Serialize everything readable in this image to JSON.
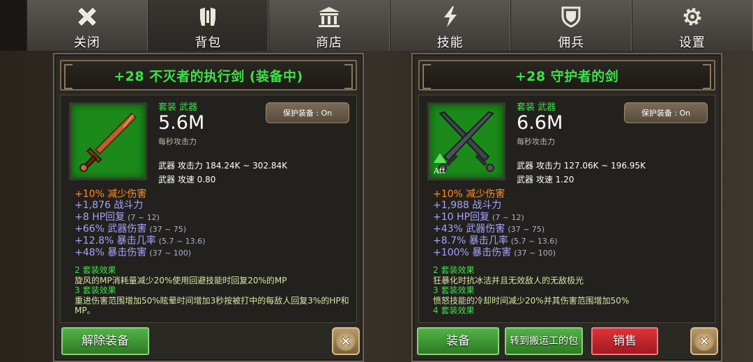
{
  "nav": {
    "tabs": [
      {
        "label": "关闭",
        "icon": "close-x-icon"
      },
      {
        "label": "背包",
        "icon": "armor-icon"
      },
      {
        "label": "商店",
        "icon": "temple-icon"
      },
      {
        "label": "技能",
        "icon": "lightning-icon"
      },
      {
        "label": "佣兵",
        "icon": "shield-icon"
      },
      {
        "label": "设置",
        "icon": "gear-icon"
      }
    ],
    "active_index": 1
  },
  "left": {
    "title": "+28 不灭者的执行剑 (装备中)",
    "set_type": "套装 武器",
    "power": "5.6M",
    "power_sub": "每秒攻击力",
    "protect": "保护装备 : On",
    "attack": "武器 攻击力 184.24K ~ 302.84K",
    "speed": "武器 攻速 0.80",
    "attrs": [
      {
        "text": "+10% 减少伤害",
        "range": "",
        "color": "orange"
      },
      {
        "text": "+1,876 战斗力",
        "range": "",
        "color": "purple"
      },
      {
        "text": "+8 HP回复",
        "range": "(7 ~ 12)",
        "color": "purple"
      },
      {
        "text": "+66% 武器伤害",
        "range": "(37 ~ 75)",
        "color": "purple"
      },
      {
        "text": "+12.8% 暴击几率",
        "range": "(5.7 ~ 13.6)",
        "color": "purple"
      },
      {
        "text": "+48% 暴击伤害",
        "range": "(37 ~ 100)",
        "color": "purple"
      }
    ],
    "set2_head": "2 套装效果",
    "set2_desc": "旋风的MP消耗量减少20%使用回避技能时回复20%的MP",
    "set3_head": "3 套装效果",
    "set3_desc": "重进伤害范围增加50%眩晕时间增加3秒按被打中的每敌人回复3%的HP和MP。",
    "btn_unequip": "解除装备"
  },
  "right": {
    "title": "+28 守护者的剑",
    "set_type": "套装 武器",
    "power": "6.6M",
    "power_sub": "每秒攻击力",
    "protect": "保护装备 : On",
    "attack": "武器 攻击力 127.06K ~ 196.95K",
    "speed": "武器 攻速 1.20",
    "icon_badge": "Att",
    "attrs": [
      {
        "text": "+10% 减少伤害",
        "range": "",
        "color": "orange"
      },
      {
        "text": "+1,988 战斗力",
        "range": "",
        "color": "purple"
      },
      {
        "text": "+10 HP回复",
        "range": "(7 ~ 12)",
        "color": "purple"
      },
      {
        "text": "+43% 武器伤害",
        "range": "(37 ~ 75)",
        "color": "purple"
      },
      {
        "text": "+8.7% 暴击几率",
        "range": "(5.7 ~ 13.6)",
        "color": "purple"
      },
      {
        "text": "+100% 暴击伤害",
        "range": "(37 ~ 100)",
        "color": "purple"
      }
    ],
    "set2_head": "2 套装效果",
    "set2_desc": "狂暴化时抗冰洁并且无效敌人的无敌极光",
    "set3_head": "3 套装效果",
    "set3_desc": "愤怒技能的冷却时间减少20%并其伤害范围增加50%",
    "set4_head": "4 套装效果",
    "btn_equip": "装备",
    "btn_transfer": "转到搬运工的包",
    "btn_sell": "销售"
  },
  "colors": {
    "title_green": "#3ce24a",
    "attr_orange": "#ff8d2b",
    "attr_purple": "#a8a3ff",
    "button_green": "#3d9a32",
    "button_red": "#c8232b"
  }
}
